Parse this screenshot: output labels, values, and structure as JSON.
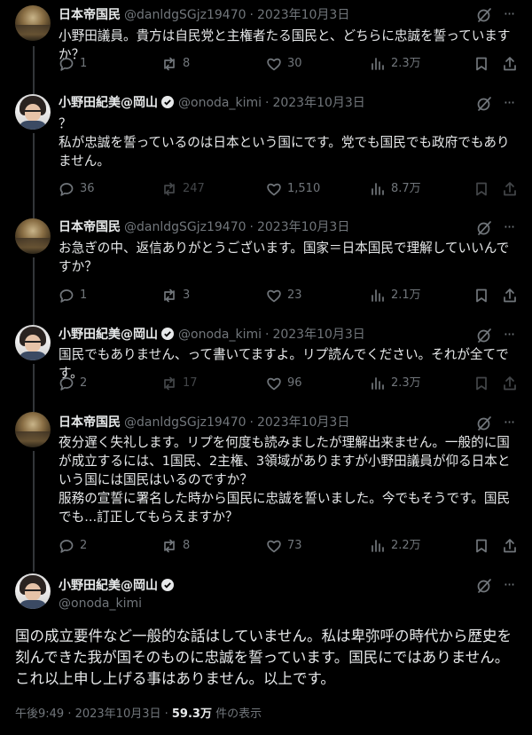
{
  "tweets": [
    {
      "name": "日本帝国民",
      "handle": "@danldgSGjz19470",
      "date": "2023年10月3日",
      "text": "小野田議員。貴方は自民党と主権者たる国民と、どちらに忠誠を誓っていますか？",
      "replies": "1",
      "retweets": "8",
      "likes": "30",
      "views": "2.3万"
    },
    {
      "name": "小野田紀美@岡山",
      "handle": "@onoda_kimi",
      "date": "2023年10月3日",
      "text": "？\n私が忠誠を誓っているのは日本という国にです。党でも国民でも政府でもありません。",
      "replies": "36",
      "retweets": "247",
      "likes": "1,510",
      "views": "8.7万"
    },
    {
      "name": "日本帝国民",
      "handle": "@danldgSGjz19470",
      "date": "2023年10月3日",
      "text": "お急ぎの中、返信ありがとうございます。国家＝日本国民で理解していいんですか？",
      "replies": "1",
      "retweets": "3",
      "likes": "23",
      "views": "2.1万"
    },
    {
      "name": "小野田紀美@岡山",
      "handle": "@onoda_kimi",
      "date": "2023年10月3日",
      "text": "国民でもありません、って書いてますよ。リプ読んでください。それが全てです。",
      "replies": "2",
      "retweets": "17",
      "likes": "96",
      "views": "2.3万"
    },
    {
      "name": "日本帝国民",
      "handle": "@danldgSGjz19470",
      "date": "2023年10月3日",
      "text": "夜分遅く失礼します。リプを何度も読みましたが理解出来ません。一般的に国が成立するには、1国民、2主権、3領域がありますが小野田議員が仰る日本という国には国民はいるのですか？\n服務の宣誓に署名した時から国民に忠誠を誓いました。今でもそうです。国民でも...訂正してもらえますか？",
      "replies": "2",
      "retweets": "8",
      "likes": "73",
      "views": "2.2万"
    }
  ],
  "main": {
    "name": "小野田紀美@岡山",
    "handle": "@onoda_kimi",
    "text": "国の成立要件など一般的な話はしていません。私は卑弥呼の時代から歴史を刻んできた我が国そのものに忠誠を誓っています。国民にではありません。これ以上申し上げる事はありません。以上です。",
    "time": "午後9:49 · 2023年10月3日 · ",
    "views_count": "59.3万",
    "views_label": " 件の表示"
  },
  "sep": "·",
  "colors": {
    "bg": "#000000",
    "text": "#e7e9ea",
    "muted": "#71767b",
    "verified": "#1d9bf0"
  }
}
